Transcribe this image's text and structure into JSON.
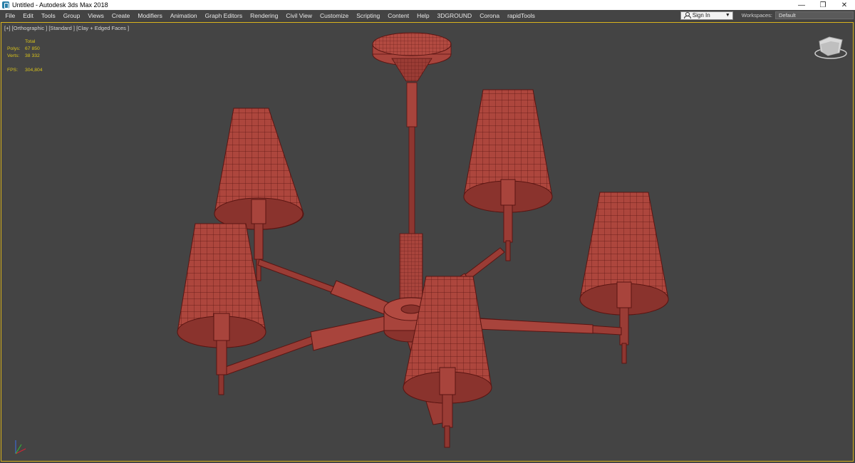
{
  "window": {
    "title": "Untitled - Autodesk 3ds Max 2018",
    "controls": [
      "—",
      "❐",
      "✕"
    ]
  },
  "menu": {
    "items": [
      "File",
      "Edit",
      "Tools",
      "Group",
      "Views",
      "Create",
      "Modifiers",
      "Animation",
      "Graph Editors",
      "Rendering",
      "Civil View",
      "Customize",
      "Scripting",
      "Content",
      "Help",
      "3DGROUND",
      "Corona",
      "rapidTools"
    ],
    "signin_label": "Sign In",
    "workspaces_label": "Workspaces:",
    "workspace_value": "Default"
  },
  "viewport": {
    "label": "[+] [Orthographic ] [Standard ] [Clay + Edged Faces ]",
    "stats": {
      "header": "Total",
      "polys_label": "Polys:",
      "polys_value": "67 850",
      "verts_label": "Verts:",
      "verts_value": "38 332",
      "fps_label": "FPS:",
      "fps_value": "304,804"
    }
  },
  "colors": {
    "model_fill": "#a8443c",
    "model_wire": "#5a1512",
    "stats_text": "#d8c21a",
    "viewport_border": "#d8b21c"
  },
  "icons": [
    "app-icon",
    "user-icon",
    "viewcube-icon",
    "axis-gizmo-icon"
  ]
}
